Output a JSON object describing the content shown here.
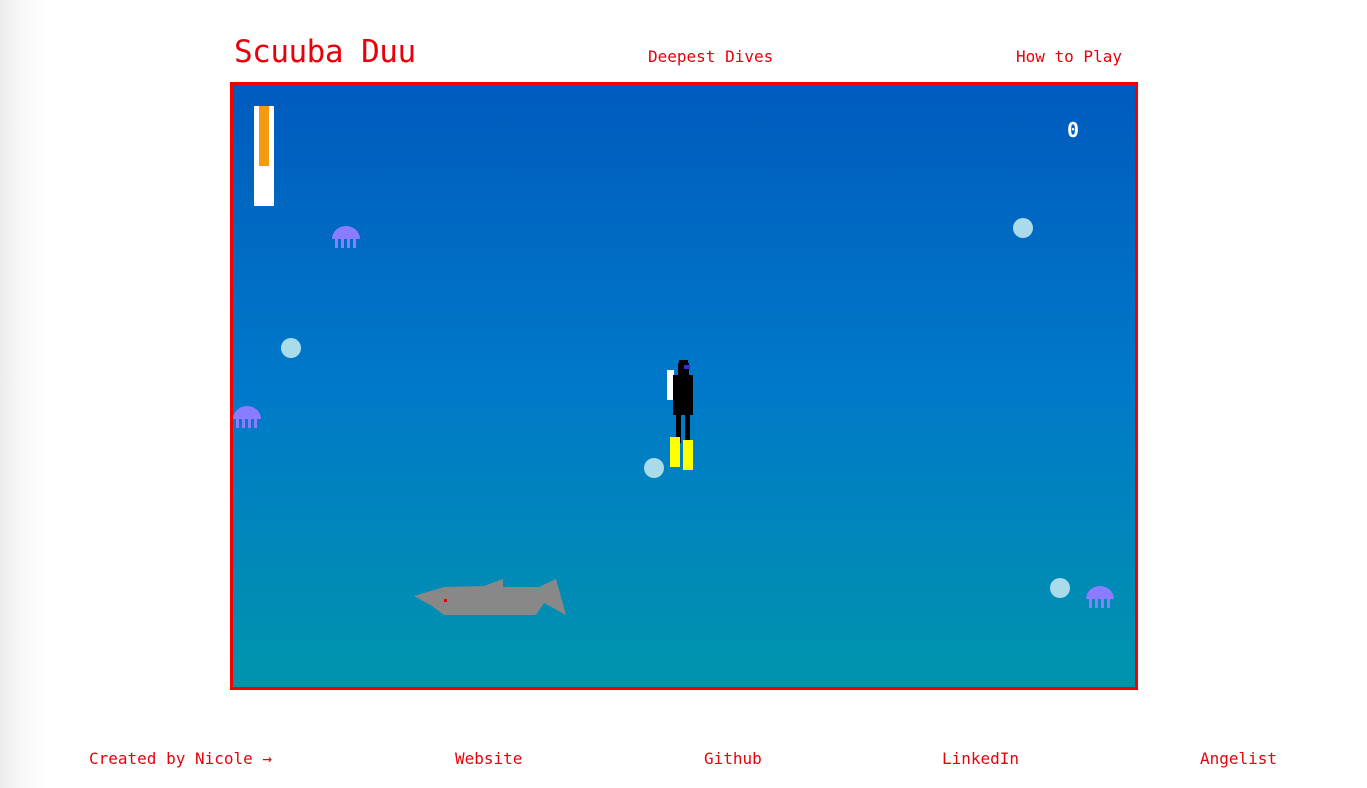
{
  "header": {
    "title": "Scuuba Duu",
    "nav": {
      "deepest_dives": "Deepest Dives",
      "how_to_play": "How to Play"
    }
  },
  "game": {
    "score": "0",
    "air_level": 0.6,
    "colors": {
      "border": "#f00000",
      "water_top": "#005bbd",
      "water_bottom": "#0094ac",
      "air": "#f39c12",
      "bubble": "#a9dbeb",
      "jellyfish": "#8a7cff",
      "shark": "#888888",
      "fins": "#ffff00"
    }
  },
  "footer": {
    "created_by": "Created by Nicole →",
    "website": "Website",
    "github": "Github",
    "linkedin": "LinkedIn",
    "angelist": "Angelist"
  },
  "theme": {
    "accent": "#e8000b"
  }
}
